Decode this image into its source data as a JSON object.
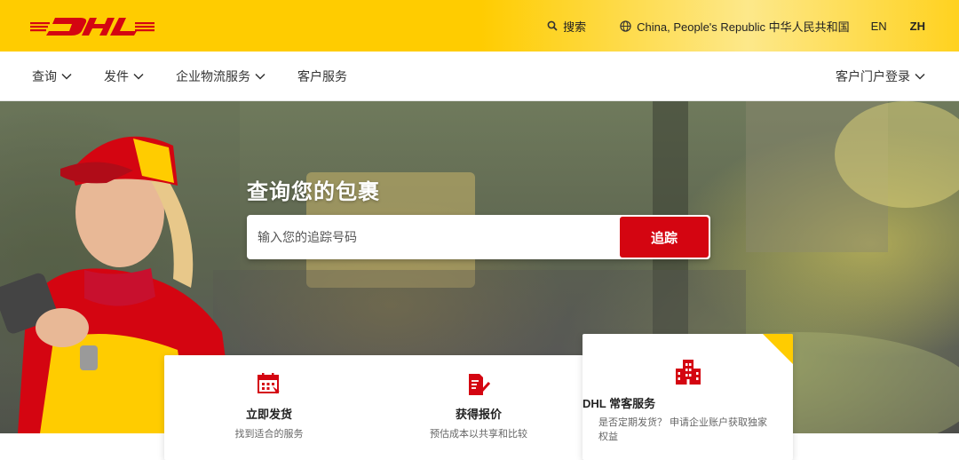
{
  "header": {
    "search_label": "搜索",
    "country": "China, People's Republic 中华人民共和国",
    "lang_en": "EN",
    "lang_zh": "ZH"
  },
  "nav": {
    "items": [
      {
        "label": "查询"
      },
      {
        "label": "发件"
      },
      {
        "label": "企业物流服务"
      },
      {
        "label": "客户服务"
      }
    ],
    "portal_login": "客户门户登录"
  },
  "hero": {
    "title": "查询您的包裹",
    "search_placeholder": "输入您的追踪号码",
    "track_button": "追踪"
  },
  "cards": [
    {
      "title": "立即发货",
      "subtitle": "找到适合的服务",
      "icon": "calendar-icon"
    },
    {
      "title": "获得报价",
      "subtitle": "预估成本以共享和比较",
      "icon": "quote-document-icon"
    },
    {
      "title": "DHL 常客服务",
      "subtitle": "是否定期发货？ 申请企业账户获取独家权益",
      "icon": "building-icon"
    }
  ],
  "colors": {
    "brand_yellow": "#ffcc00",
    "brand_red": "#d40511"
  }
}
